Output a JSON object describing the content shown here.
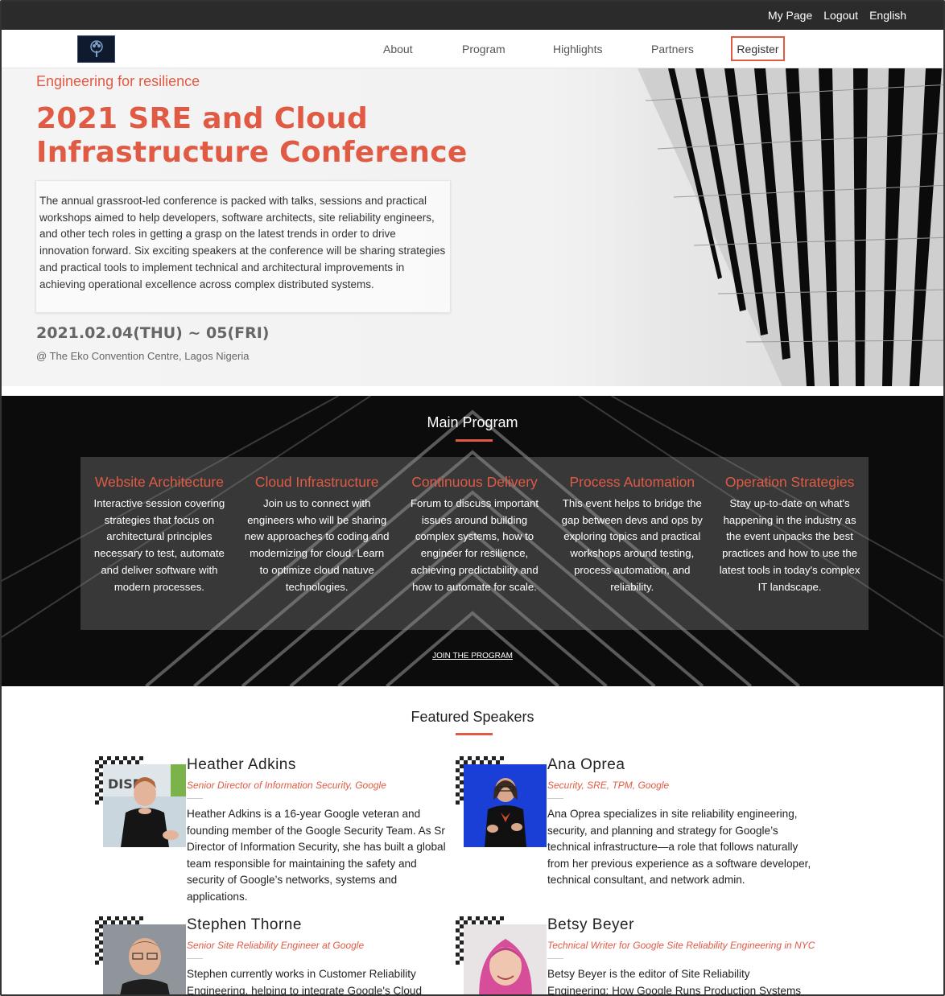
{
  "topbar": {
    "my_page": "My Page",
    "logout": "Logout",
    "language": "English"
  },
  "nav": {
    "items": [
      {
        "label": "About"
      },
      {
        "label": "Program"
      },
      {
        "label": "Highlights"
      },
      {
        "label": "Partners"
      }
    ],
    "register": "Register"
  },
  "hero": {
    "tagline": "Engineering for resilience",
    "title": "2021 SRE and Cloud Infrastructure Conference",
    "description": "The annual grassroot-led conference is packed with talks, sessions and practical workshops aimed to help developers, software architects, site reliability engineers, and other tech roles in getting a grasp on the latest trends in order to drive innovation forward. Six exciting speakers at the conference will be sharing strategies and practical tools to implement technical and architectural improvements in achieving operational excellence across complex distributed systems.",
    "dates": "2021.02.04(THU) ~ 05(FRI)",
    "venue": "@ The Eko Convention Centre, Lagos Nigeria"
  },
  "program": {
    "heading": "Main Program",
    "columns": [
      {
        "title": "Website Architecture",
        "desc": "Interactive session covering strategies that focus on architectural principles necessary to test, automate and deliver software with modern processes."
      },
      {
        "title": "Cloud Infrastructure",
        "desc": "Join us to connect with engineers who will be sharing new approaches to coding and modernizing for cloud. Learn to optimize cloud natuve technologies."
      },
      {
        "title": "Continuous Delivery",
        "desc": "Forum to discuss important issues around building complex systems, how to engineer for resilience, achieving predictability and how to automate for scale."
      },
      {
        "title": "Process Automation",
        "desc": "This event helps to bridge the gap between devs and ops by exploring topics and practical workshops around testing, process automation, and reliability."
      },
      {
        "title": "Operation Strategies",
        "desc": "Stay up-to-date on what's happening in the industry as the event unpacks the best practices and how to use the latest tools in today's complex IT landscape."
      }
    ],
    "join": "JOIN THE PROGRAM"
  },
  "speakers": {
    "heading": "Featured Speakers",
    "list": [
      {
        "name": "Heather Adkins",
        "role": "Senior Director of Information Security, Google",
        "bio": "Heather Adkins is a 16-year Google veteran and founding member of the Google Security Team. As Sr Director of Information Security, she has built a global team responsible for maintaining the safety and security of Google’s networks, systems and applications.",
        "photo_text": "DISRU"
      },
      {
        "name": "Ana Oprea",
        "role": "Security, SRE, TPM, Google",
        "bio": "Ana Oprea specializes in site reliability engineering, security, and planning and strategy for Google’s technical infrastructure—a role that follows naturally from her previous experience as a software developer, technical consultant, and network admin."
      },
      {
        "name": "Stephen Thorne",
        "role": "Senior Site Reliability Engineer at Google",
        "bio": "Stephen currently works in Customer Reliability Engineering, helping to integrate Google's Cloud"
      },
      {
        "name": "Betsy Beyer",
        "role": "Technical Writer for Google Site Reliability Engineering in NYC",
        "bio": "Betsy Beyer is the editor of Site Reliability Engineering: How Google Runs Production Systems and The Site"
      }
    ]
  }
}
